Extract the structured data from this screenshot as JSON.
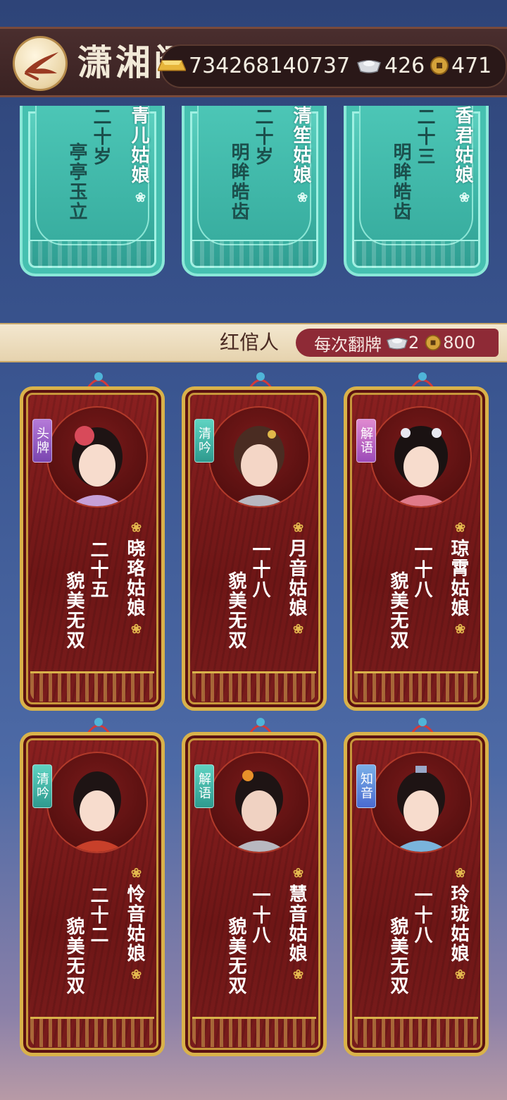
{
  "header": {
    "title": "潇湘阁",
    "gold": "734268140737",
    "silver": "426",
    "coins": "471"
  },
  "top_cards": [
    {
      "name": "青儿姑娘",
      "age": "二十岁",
      "desc": "亭亭玉立"
    },
    {
      "name": "清笙姑娘",
      "age": "二十岁",
      "desc": "明眸皓齿"
    },
    {
      "name": "香君姑娘",
      "age": "二十三",
      "desc": "明眸皓齿"
    }
  ],
  "section": {
    "title": "红倌人",
    "cost_label": "每次翻牌",
    "cost_silver": "2",
    "cost_coins": "800"
  },
  "cards": [
    {
      "badge": "头牌",
      "name": "晓珞姑娘",
      "age": "二十五",
      "desc": "貌美无双"
    },
    {
      "badge": "清吟",
      "name": "月音姑娘",
      "age": "一十八",
      "desc": "貌美无双"
    },
    {
      "badge": "解语",
      "name": "琼霄姑娘",
      "age": "一十八",
      "desc": "貌美无双"
    },
    {
      "badge": "清吟",
      "name": "怜音姑娘",
      "age": "二十二",
      "desc": "貌美无双"
    },
    {
      "badge": "解语",
      "name": "慧音姑娘",
      "age": "一十八",
      "desc": "貌美无双"
    },
    {
      "badge": "知音",
      "name": "玲珑姑娘",
      "age": "一十八",
      "desc": "貌美无双"
    }
  ],
  "icons": {
    "back": "fan-back-icon",
    "gold": "gold-ingot-icon",
    "silver": "silver-ingot-icon",
    "coin": "copper-coin-icon",
    "flower": "flower-icon"
  },
  "colors": {
    "top_bar": "#3a2222",
    "jade": "#3fb7a8",
    "card_wood": "#7a1c1c",
    "card_gold": "#d9b24a",
    "cost_pill": "#8e2a36"
  }
}
